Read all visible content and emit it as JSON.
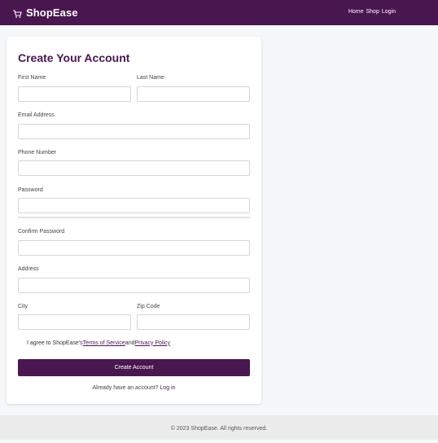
{
  "header": {
    "brand": "ShopEase",
    "nav": [
      "Home",
      "Shop",
      "Login"
    ]
  },
  "form": {
    "title": "Create Your Account",
    "fields": {
      "first_name": {
        "label": "First Name",
        "value": ""
      },
      "last_name": {
        "label": "Last Name",
        "value": ""
      },
      "email": {
        "label": "Email Address",
        "value": ""
      },
      "phone": {
        "label": "Phone Number",
        "value": ""
      },
      "password": {
        "label": "Password",
        "value": ""
      },
      "confirm_password": {
        "label": "Confirm Password",
        "value": ""
      },
      "address": {
        "label": "Address",
        "value": ""
      },
      "city": {
        "label": "City",
        "value": ""
      },
      "zip": {
        "label": "Zip Code",
        "value": ""
      }
    },
    "terms": {
      "prefix": "I agree to ShopEase's",
      "terms_link": " Terms of Service",
      "conjunction": " and",
      "privacy_link": " Privacy Policy"
    },
    "submit_label": "Create Account",
    "login_prompt": "Already have an account?",
    "login_link": "Log in"
  },
  "footer": {
    "text": "© 2023 ShopEase. All rights reserved."
  },
  "colors": {
    "brand": "#4a1650",
    "page_background": "#f6f7f9",
    "footer_background": "#ececec"
  },
  "icons": {
    "cart": "shopping-cart-icon"
  }
}
